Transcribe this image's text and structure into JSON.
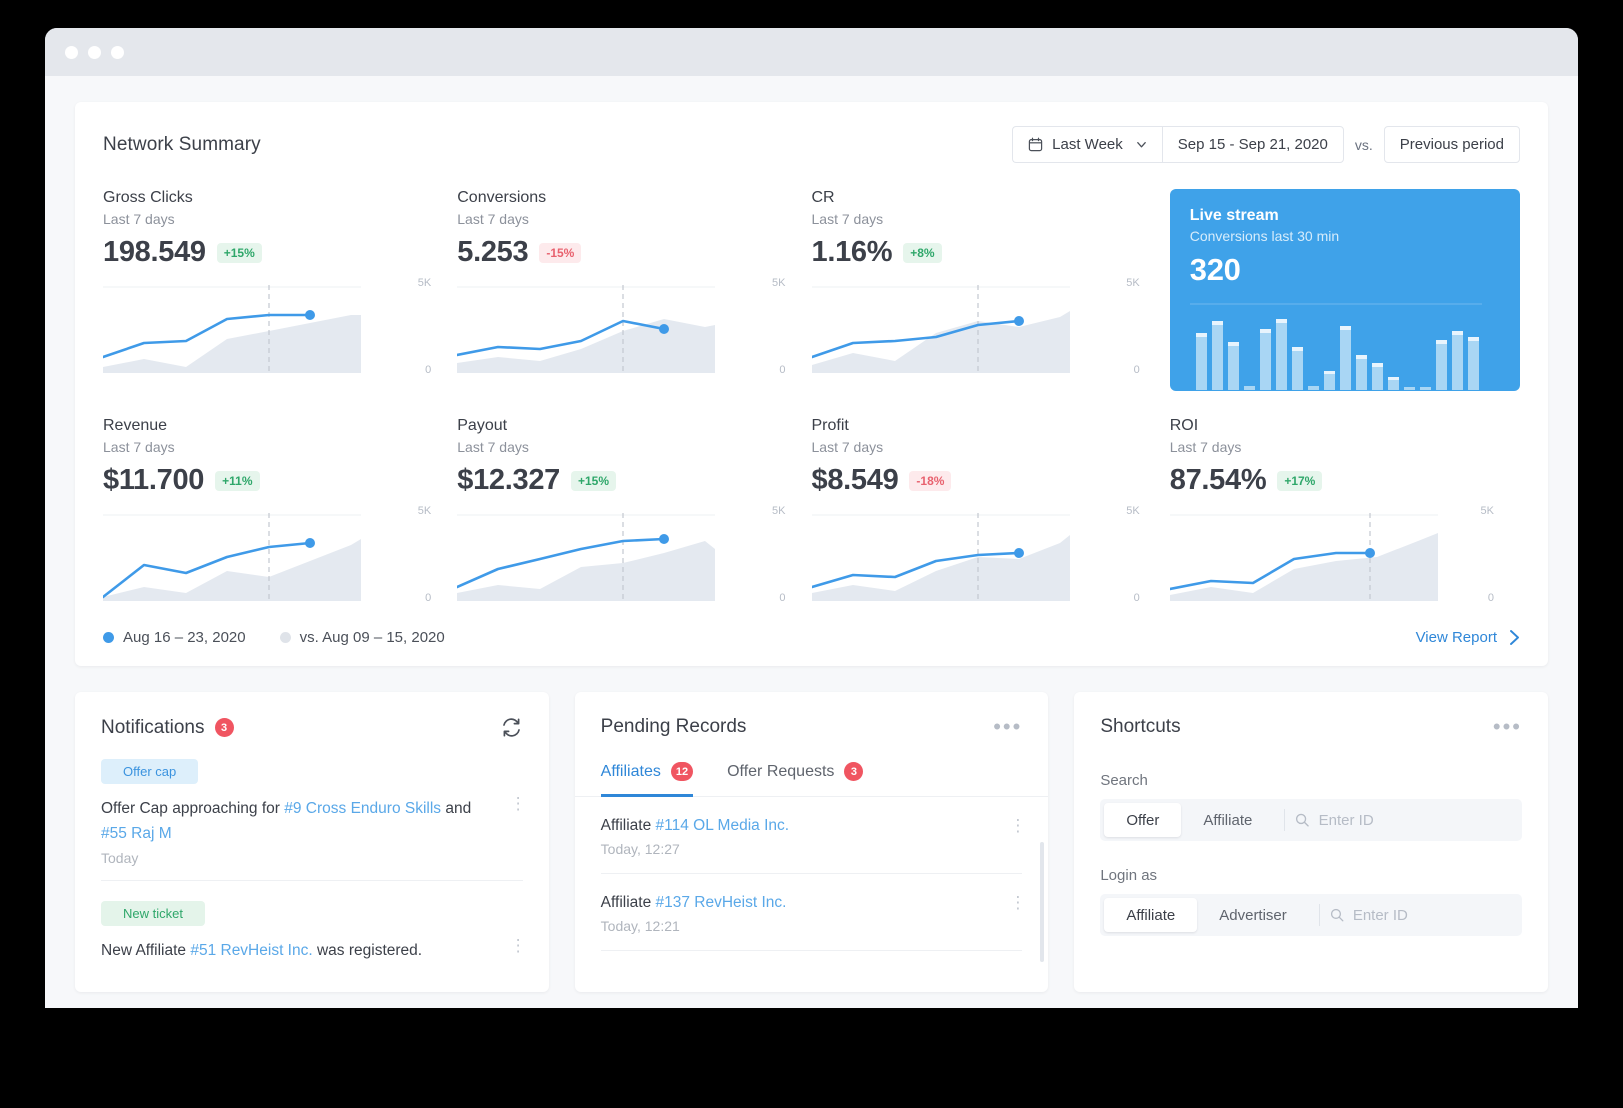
{
  "window": {
    "dots": [
      "close",
      "minimize",
      "maximize"
    ]
  },
  "summary": {
    "title": "Network Summary",
    "range_preset": "Last Week",
    "range_dates": "Sep 15 - Sep 21, 2020",
    "vs_label": "vs.",
    "compare": "Previous period",
    "legend": [
      {
        "label": "Aug 16 – 23, 2020",
        "color": "#3f9ae8"
      },
      {
        "label": "vs. Aug 09 – 15, 2020",
        "color": "#dfe3e9"
      }
    ],
    "view_report": "View Report",
    "kpis": [
      {
        "title": "Gross Clicks",
        "sub": "Last 7 days",
        "value": "198.549",
        "delta": "+15%",
        "dir": "up",
        "axis_top": "5K",
        "axis_bottom": "0"
      },
      {
        "title": "Conversions",
        "sub": "Last 7 days",
        "value": "5.253",
        "delta": "-15%",
        "dir": "down",
        "axis_top": "5K",
        "axis_bottom": "0"
      },
      {
        "title": "CR",
        "sub": "Last 7 days",
        "value": "1.16%",
        "delta": "+8%",
        "dir": "up",
        "axis_top": "5K",
        "axis_bottom": "0"
      },
      {
        "title": "Revenue",
        "sub": "Last 7 days",
        "value": "$11.700",
        "delta": "+11%",
        "dir": "up",
        "axis_top": "5K",
        "axis_bottom": "0"
      },
      {
        "title": "Payout",
        "sub": "Last 7 days",
        "value": "$12.327",
        "delta": "+15%",
        "dir": "up",
        "axis_top": "5K",
        "axis_bottom": "0"
      },
      {
        "title": "Profit",
        "sub": "Last 7 days",
        "value": "$8.549",
        "delta": "-18%",
        "dir": "down",
        "axis_top": "5K",
        "axis_bottom": "0"
      },
      {
        "title": "ROI",
        "sub": "Last 7 days",
        "value": "87.54%",
        "delta": "+17%",
        "dir": "up",
        "axis_top": "5K",
        "axis_bottom": "0"
      }
    ],
    "live": {
      "title": "Live stream",
      "sub": "Conversions last 30 min",
      "value": "320"
    }
  },
  "chart_data": [
    {
      "type": "line",
      "title": "Gross Clicks",
      "x": [
        0,
        1,
        2,
        3,
        4,
        5,
        6,
        7
      ],
      "series": [
        {
          "name": "Aug 16 – 23, 2020",
          "values": [
            0.22,
            0.45,
            0.47,
            0.72,
            0.74,
            0.74,
            null,
            null
          ]
        },
        {
          "name": "vs. Aug 09 – 15, 2020",
          "values": [
            0.3,
            0.36,
            0.2,
            0.46,
            0.62,
            0.6,
            0.72,
            0.83
          ]
        }
      ],
      "ylim": [
        0,
        1
      ],
      "axis_top": "5K",
      "axis_bottom": "0",
      "marker_at": 5
    },
    {
      "type": "line",
      "title": "Conversions",
      "x": [
        0,
        1,
        2,
        3,
        4,
        5,
        6,
        7
      ],
      "series": [
        {
          "name": "Aug 16 – 23, 2020",
          "values": [
            0.26,
            0.33,
            0.31,
            0.4,
            0.62,
            0.56,
            null,
            null
          ]
        },
        {
          "name": "vs. Aug 09 – 15, 2020",
          "values": [
            0.22,
            0.28,
            0.24,
            0.34,
            0.52,
            0.62,
            0.7,
            0.6
          ]
        }
      ],
      "ylim": [
        0,
        1
      ],
      "axis_top": "5K",
      "axis_bottom": "0",
      "marker_at": 5
    },
    {
      "type": "line",
      "title": "CR",
      "x": [
        0,
        1,
        2,
        3,
        4,
        5,
        6,
        7
      ],
      "series": [
        {
          "name": "Aug 16 – 23, 2020",
          "values": [
            0.24,
            0.4,
            0.44,
            0.46,
            0.6,
            0.63,
            null,
            null
          ]
        },
        {
          "name": "vs. Aug 09 – 15, 2020",
          "values": [
            0.3,
            0.38,
            0.3,
            0.5,
            0.66,
            0.6,
            0.7,
            0.8
          ]
        }
      ],
      "ylim": [
        0,
        1
      ],
      "axis_top": "5K",
      "axis_bottom": "0",
      "marker_at": 5
    },
    {
      "type": "bar",
      "title": "Live stream — Conversions last 30 min",
      "values": [
        0.62,
        0.8,
        0.52,
        0,
        0.66,
        0.82,
        0.46,
        0,
        0.18,
        0.7,
        0.38,
        0.3,
        0.1,
        0,
        0,
        0.16,
        0.66,
        0.36,
        0.28,
        0.06,
        0,
        0.58,
        0.72,
        0.54
      ],
      "ylim": [
        0,
        1
      ]
    },
    {
      "type": "line",
      "title": "Revenue",
      "x": [
        0,
        1,
        2,
        3,
        4,
        5,
        6,
        7
      ],
      "series": [
        {
          "name": "Aug 16 – 23, 2020",
          "values": [
            0.1,
            0.5,
            0.42,
            0.6,
            0.72,
            0.72,
            null,
            null
          ]
        },
        {
          "name": "vs. Aug 09 – 15, 2020",
          "values": [
            0.2,
            0.32,
            0.22,
            0.46,
            0.4,
            0.52,
            0.7,
            0.8
          ]
        }
      ],
      "ylim": [
        0,
        1
      ],
      "axis_top": "5K",
      "axis_bottom": "0",
      "marker_at": 5
    },
    {
      "type": "line",
      "title": "Payout",
      "x": [
        0,
        1,
        2,
        3,
        4,
        5,
        6,
        7
      ],
      "series": [
        {
          "name": "Aug 16 – 23, 2020",
          "values": [
            0.22,
            0.46,
            0.56,
            0.68,
            0.78,
            0.8,
            null,
            null
          ]
        },
        {
          "name": "vs. Aug 09 – 15, 2020",
          "values": [
            0.26,
            0.34,
            0.3,
            0.5,
            0.56,
            0.64,
            0.78,
            0.7
          ]
        }
      ],
      "ylim": [
        0,
        1
      ],
      "axis_top": "5K",
      "axis_bottom": "0",
      "marker_at": 5
    },
    {
      "type": "line",
      "title": "Profit",
      "x": [
        0,
        1,
        2,
        3,
        4,
        5,
        6,
        7
      ],
      "series": [
        {
          "name": "Aug 16 – 23, 2020",
          "values": [
            0.24,
            0.4,
            0.38,
            0.54,
            0.6,
            0.62,
            null,
            null
          ]
        },
        {
          "name": "vs. Aug 09 – 15, 2020",
          "values": [
            0.28,
            0.34,
            0.28,
            0.46,
            0.58,
            0.56,
            0.74,
            0.82
          ]
        }
      ],
      "ylim": [
        0,
        1
      ],
      "axis_top": "5K",
      "axis_bottom": "0",
      "marker_at": 5
    },
    {
      "type": "line",
      "title": "ROI",
      "x": [
        0,
        1,
        2,
        3,
        4,
        5,
        6,
        7
      ],
      "series": [
        {
          "name": "Aug 16 – 23, 2020",
          "values": [
            0.2,
            0.34,
            0.3,
            0.56,
            0.62,
            0.64,
            null,
            null
          ]
        },
        {
          "name": "vs. Aug 09 – 15, 2020",
          "values": [
            0.26,
            0.32,
            0.26,
            0.44,
            0.54,
            0.58,
            0.76,
            0.84
          ]
        }
      ],
      "ylim": [
        0,
        1
      ],
      "axis_top": "5K",
      "axis_bottom": "0",
      "marker_at": 5
    }
  ],
  "notifications": {
    "title": "Notifications",
    "count": "3",
    "items": [
      {
        "tag": "Offer cap",
        "tag_style": "blue",
        "text_before": "Offer Cap approaching for ",
        "link1": "#9 Cross Enduro Skills",
        "text_mid": " and ",
        "link2": "#55 Raj M",
        "text_after": "",
        "time": "Today"
      },
      {
        "tag": "New ticket",
        "tag_style": "green",
        "text_before": "New Affiliate ",
        "link1": "#51 RevHeist Inc.",
        "text_mid": "  was registered.",
        "link2": "",
        "text_after": "",
        "time": ""
      }
    ]
  },
  "pending": {
    "title": "Pending Records",
    "tabs": [
      {
        "label": "Affiliates",
        "count": "12",
        "active": true
      },
      {
        "label": "Offer Requests",
        "count": "3",
        "active": false
      }
    ],
    "records": [
      {
        "prefix": "Affiliate ",
        "link": "#114 OL Media Inc.",
        "time": "Today, 12:27"
      },
      {
        "prefix": "Affiliate ",
        "link": "#137 RevHeist Inc.",
        "time": "Today, 12:21"
      }
    ]
  },
  "shortcuts": {
    "title": "Shortcuts",
    "search_label": "Search",
    "search_options": [
      {
        "label": "Offer",
        "on": true
      },
      {
        "label": "Affiliate",
        "on": false
      }
    ],
    "search_placeholder": "Enter ID",
    "login_label": "Login as",
    "login_options": [
      {
        "label": "Affiliate",
        "on": true
      },
      {
        "label": "Advertiser",
        "on": false
      }
    ],
    "login_placeholder": "Enter ID"
  },
  "colors": {
    "accent": "#3f9ae8",
    "up": "#2fa76a",
    "down": "#e8616e",
    "badge": "#f05561"
  }
}
